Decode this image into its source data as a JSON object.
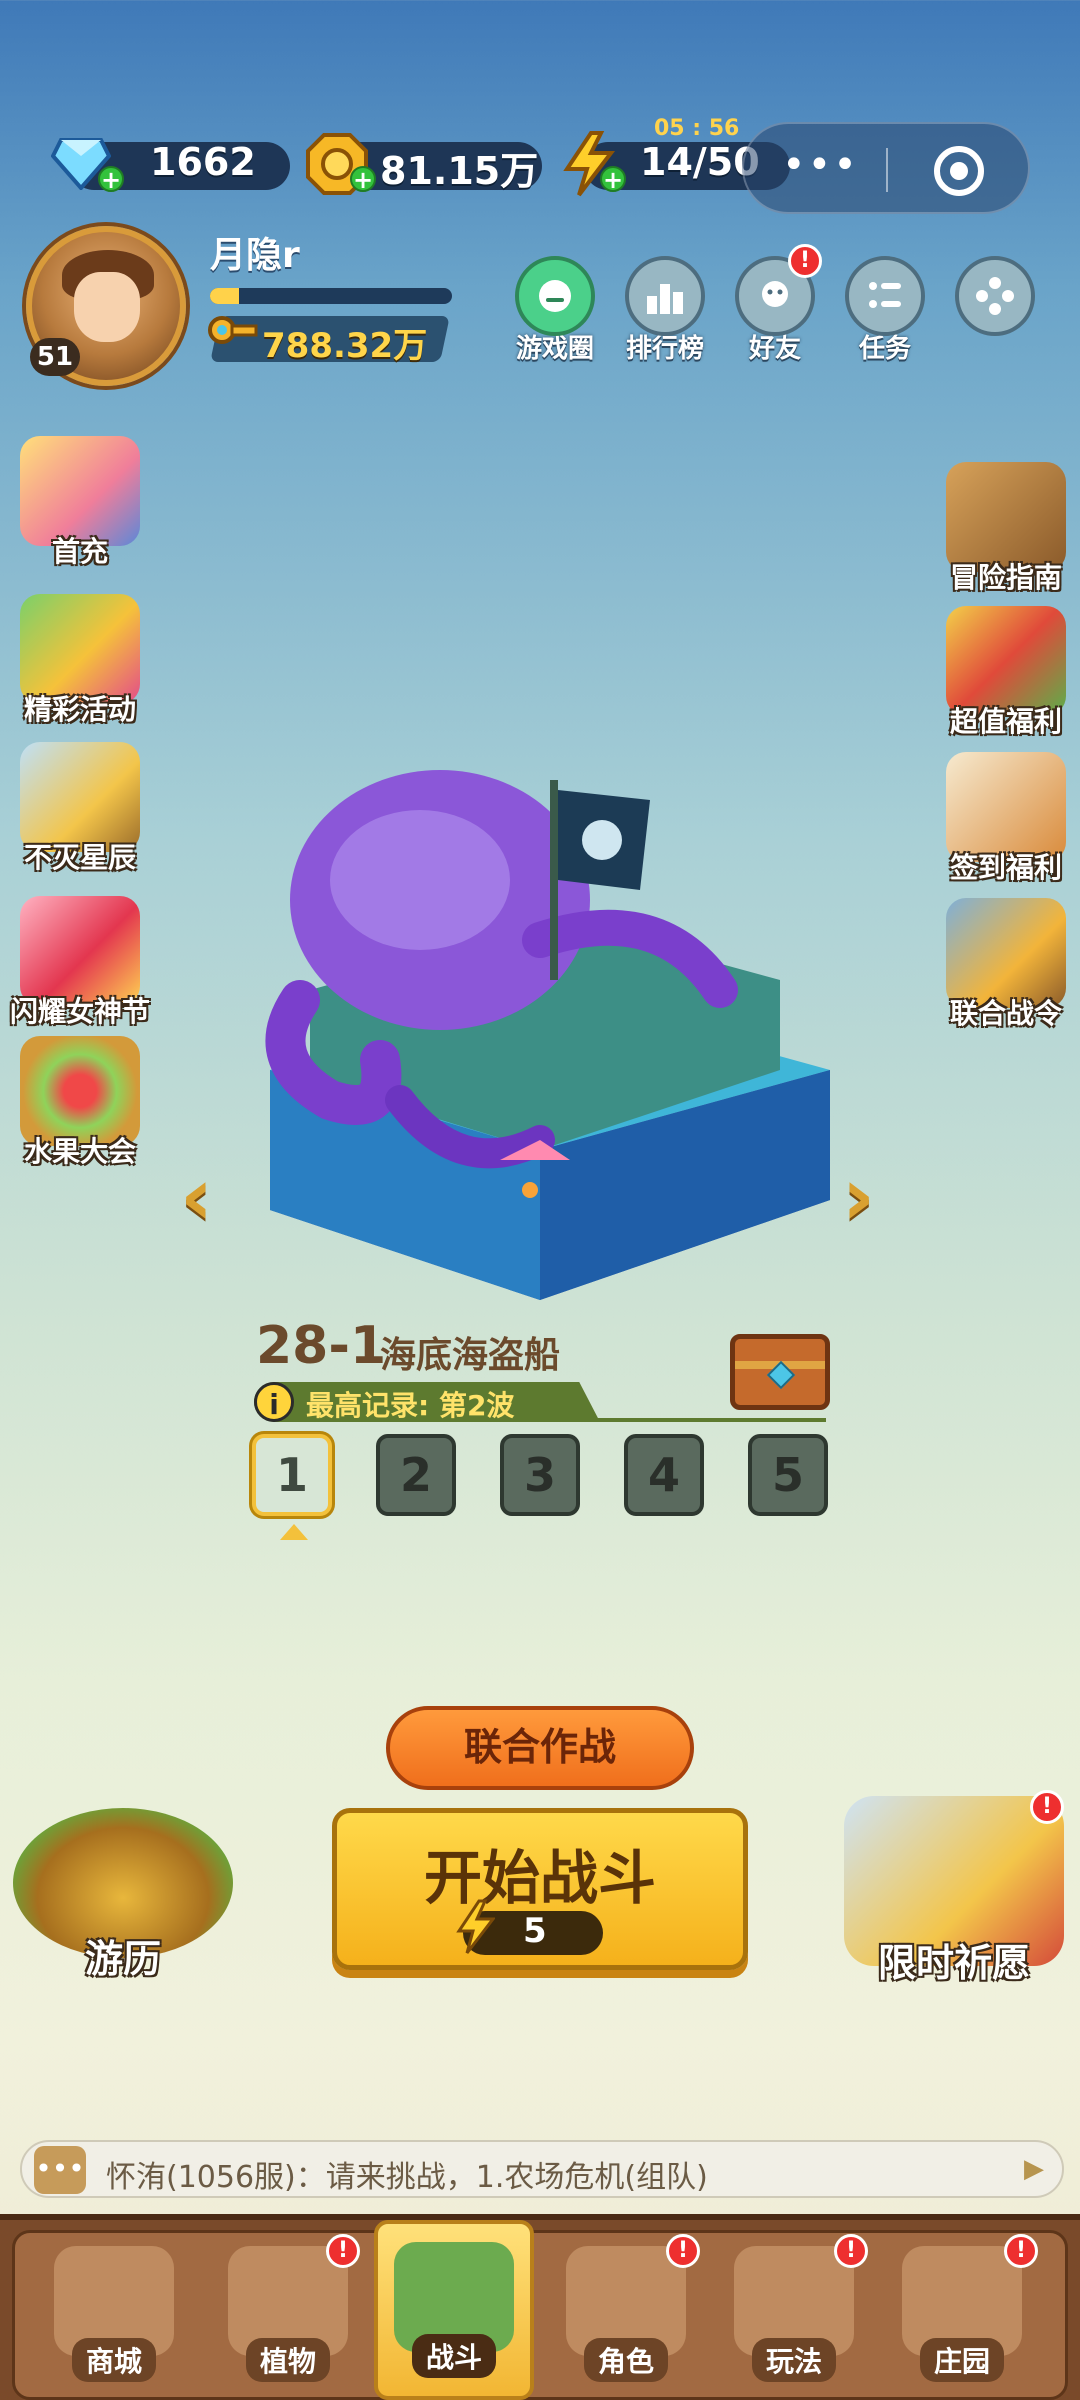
{
  "topbar": {
    "gems": "1662",
    "coins": "81.15万",
    "energy": "14/50",
    "energy_timer": "05 : 56"
  },
  "profile": {
    "name": "月隐r",
    "level": "51",
    "gold": "788.32万",
    "xp_fraction": 0.12
  },
  "header_buttons": [
    {
      "label": "游戏圈",
      "icon": "chat-bubble-icon",
      "badge": ""
    },
    {
      "label": "排行榜",
      "icon": "leaderboard-icon",
      "badge": ""
    },
    {
      "label": "好友",
      "icon": "friends-icon",
      "badge": "!"
    },
    {
      "label": "任务",
      "icon": "tasks-icon",
      "badge": ""
    },
    {
      "label": "",
      "icon": "gamepad-icon",
      "badge": ""
    }
  ],
  "left_features": [
    {
      "label": "首充"
    },
    {
      "label": "精彩活动"
    },
    {
      "label": "不灭星辰"
    },
    {
      "label": "闪耀女神节"
    },
    {
      "label": "水果大会"
    }
  ],
  "right_features": [
    {
      "label": "冒险指南"
    },
    {
      "label": "超值福利"
    },
    {
      "label": "签到福利"
    },
    {
      "label": "联合战令"
    }
  ],
  "stage": {
    "number": "28-1",
    "name": "海底海盗船",
    "record_label": "最高记录: 第2波",
    "waves": [
      "1",
      "2",
      "3",
      "4",
      "5"
    ],
    "selected_wave": "1"
  },
  "actions": {
    "coop": "联合作战",
    "start": "开始战斗",
    "start_cost": "5",
    "travel": "游历",
    "wish": "限时祈愿"
  },
  "chat": {
    "message": "怀洧(1056服)：请来挑战，1.农场危机(组队)"
  },
  "nav": [
    {
      "label": "商城",
      "badge": ""
    },
    {
      "label": "植物",
      "badge": "!"
    },
    {
      "label": "战斗",
      "badge": ""
    },
    {
      "label": "角色",
      "badge": "!"
    },
    {
      "label": "玩法",
      "badge": "!"
    },
    {
      "label": "庄园",
      "badge": "!"
    }
  ],
  "colors": {
    "accent": "#f5b11b",
    "badge": "#ee2f2f"
  }
}
